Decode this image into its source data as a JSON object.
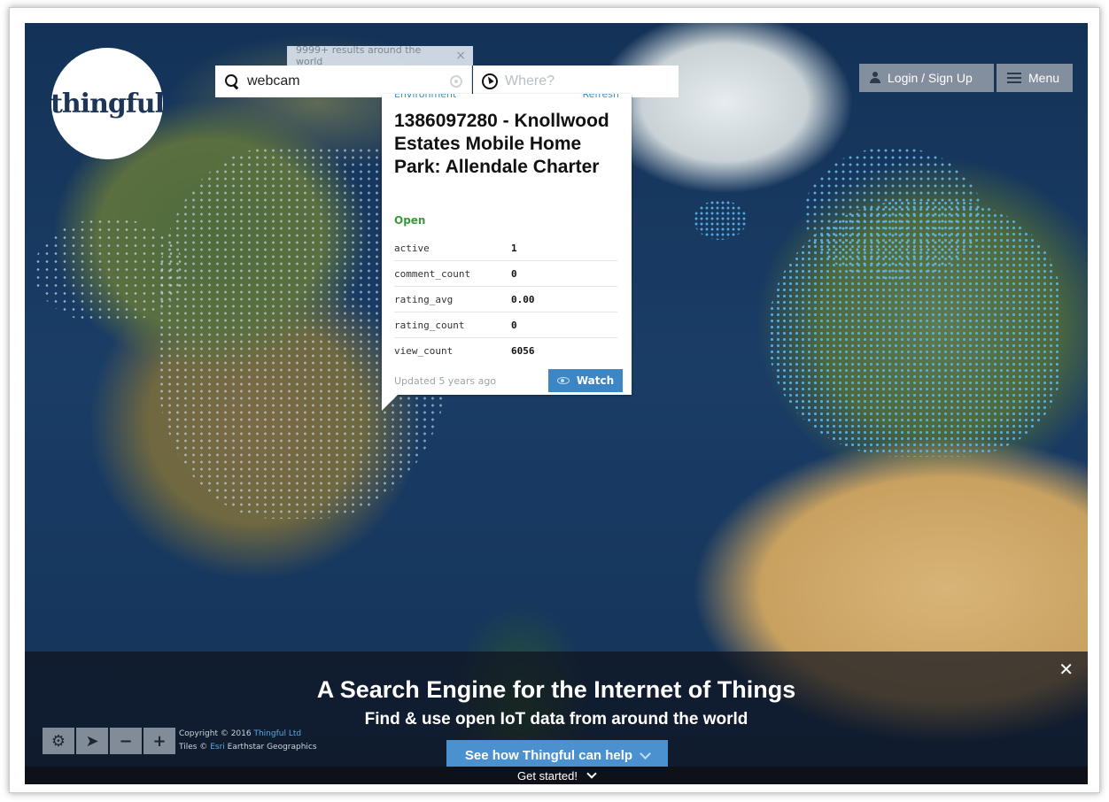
{
  "logo": {
    "text": "thingful"
  },
  "search": {
    "results_pill": "9999+ results around the world",
    "query": "webcam",
    "where_placeholder": "Where?"
  },
  "header": {
    "login_label": "Login / Sign Up",
    "menu_label": "Menu"
  },
  "card": {
    "category": "Environment",
    "refresh_label": "Refresh",
    "title": "1386097280 - Knollwood Estates Mobile Home Park: Allendale Charter",
    "status": "Open",
    "rows": [
      {
        "key": "active",
        "value": "1"
      },
      {
        "key": "comment_count",
        "value": "0"
      },
      {
        "key": "rating_avg",
        "value": "0.00"
      },
      {
        "key": "rating_count",
        "value": "0"
      },
      {
        "key": "view_count",
        "value": "6056"
      }
    ],
    "updated": "Updated 5 years ago",
    "watch_label": "Watch"
  },
  "banner": {
    "title": "A Search Engine for the Internet of Things",
    "subtitle": "Find & use open IoT data from around the world",
    "cta_label": "See how Thingful can help",
    "get_started": "Get started!"
  },
  "attribution": {
    "copyright_prefix": "Copyright © 2016",
    "copyright_link": "Thingful Ltd",
    "tiles_prefix": "Tiles ©",
    "tiles_link": "Esri",
    "tiles_suffix": "Earthstar Geographics"
  },
  "colors": {
    "accent": "#3d86c6",
    "status_open": "#3a9a3a",
    "brand_navy": "#1d3557"
  }
}
